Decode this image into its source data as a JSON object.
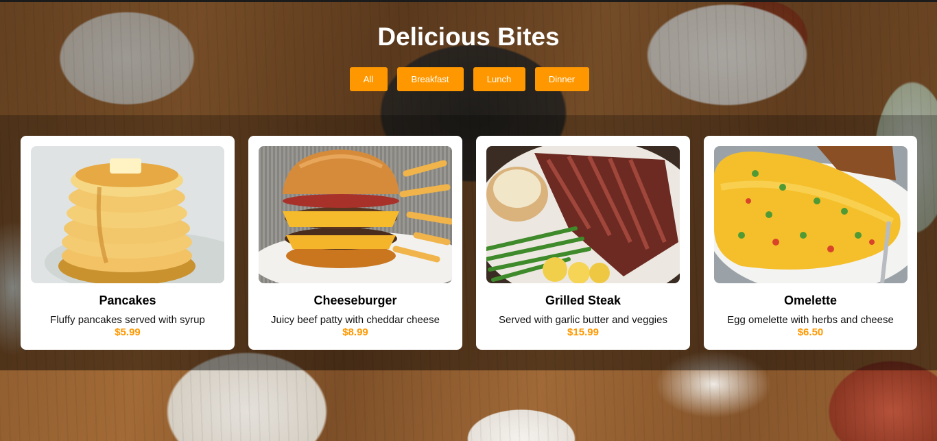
{
  "header": {
    "title": "Delicious Bites"
  },
  "filters": [
    {
      "label": "All"
    },
    {
      "label": "Breakfast"
    },
    {
      "label": "Lunch"
    },
    {
      "label": "Dinner"
    }
  ],
  "menu": [
    {
      "name": "Pancakes",
      "description": "Fluffy pancakes served with syrup",
      "price": "$5.99",
      "image": "pancakes-photo"
    },
    {
      "name": "Cheeseburger",
      "description": "Juicy beef patty with cheddar cheese",
      "price": "$8.99",
      "image": "cheeseburger-photo"
    },
    {
      "name": "Grilled Steak",
      "description": "Served with garlic butter and veggies",
      "price": "$15.99",
      "image": "grilled-steak-photo"
    },
    {
      "name": "Omelette",
      "description": "Egg omelette with herbs and cheese",
      "price": "$6.50",
      "image": "omelette-photo"
    }
  ],
  "colors": {
    "accent": "#ff9800",
    "card_background": "#ffffff",
    "title_text": "#ffffff"
  }
}
